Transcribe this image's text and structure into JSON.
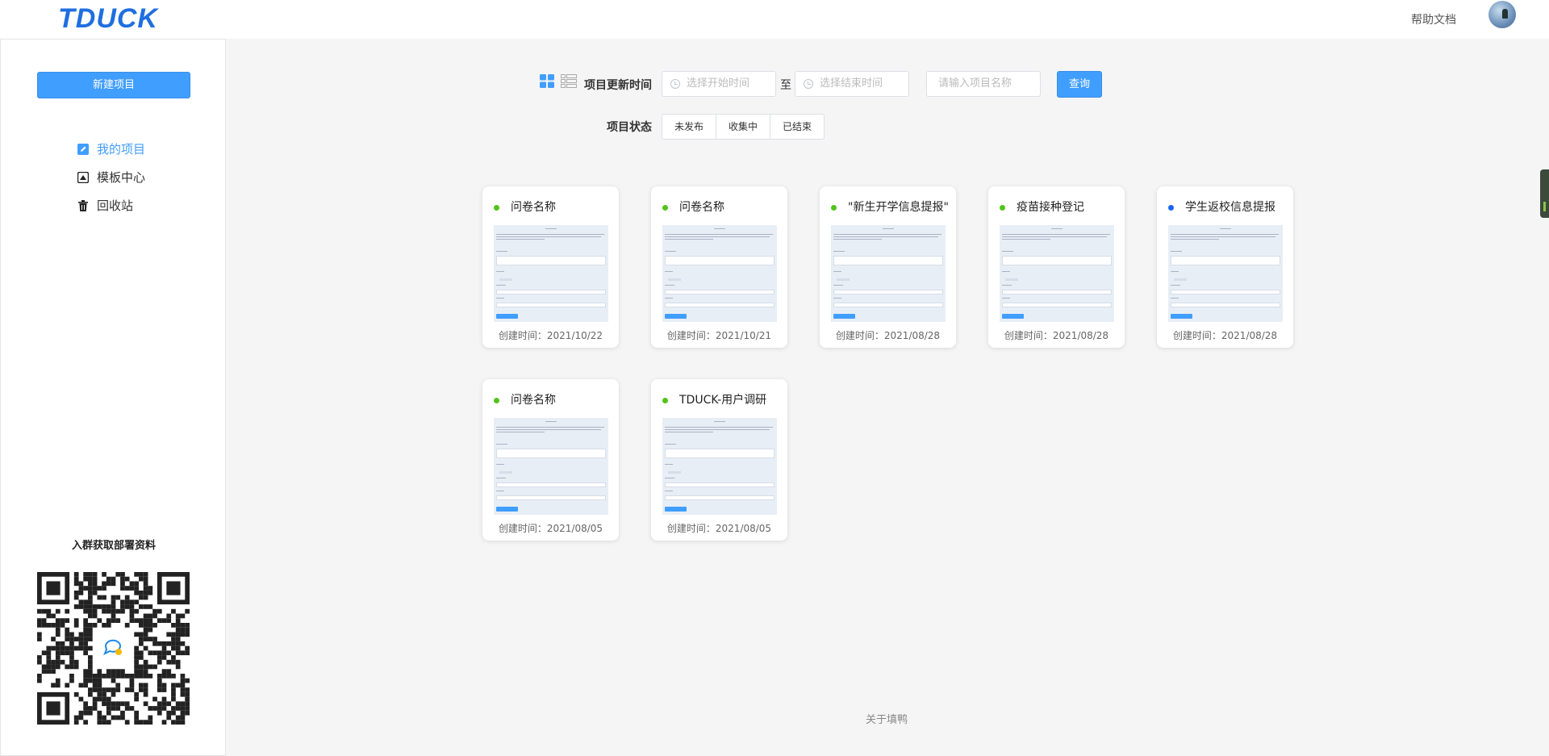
{
  "header": {
    "logo_text": "TDUCK",
    "help_link": "帮助文档"
  },
  "sidebar": {
    "new_project_button": "新建项目",
    "menu": [
      {
        "label": "我的项目",
        "icon": "edit-icon",
        "active": true
      },
      {
        "label": "模板中心",
        "icon": "template-icon",
        "active": false
      },
      {
        "label": "回收站",
        "icon": "trash-icon",
        "active": false
      }
    ],
    "qr_title": "入群获取部署资料"
  },
  "filter": {
    "update_time_label": "项目更新时间",
    "start_placeholder": "选择开始时间",
    "to_label": "至",
    "end_placeholder": "选择结束时间",
    "name_placeholder": "请输入项目名称",
    "query_button": "查询",
    "status_label": "项目状态",
    "status_options": [
      "未发布",
      "收集中",
      "已结束"
    ]
  },
  "projects": [
    {
      "title": "问卷名称",
      "created": "创建时间：2021/10/22",
      "status_color": "#52c41a"
    },
    {
      "title": "问卷名称",
      "created": "创建时间：2021/10/21",
      "status_color": "#52c41a"
    },
    {
      "title": "\"新生开学信息提报\"",
      "created": "创建时间：2021/08/28",
      "status_color": "#52c41a"
    },
    {
      "title": "疫苗接种登记",
      "created": "创建时间：2021/08/28",
      "status_color": "#52c41a"
    },
    {
      "title": "学生返校信息提报",
      "created": "创建时间：2021/08/28",
      "status_color": "#1765f0"
    },
    {
      "title": "问卷名称",
      "created": "创建时间：2021/08/05",
      "status_color": "#52c41a"
    },
    {
      "title": "TDUCK-用户调研",
      "created": "创建时间：2021/08/05",
      "status_color": "#52c41a"
    }
  ],
  "footer": {
    "about": "关于填鸭"
  },
  "colors": {
    "primary": "#409eff",
    "published": "#52c41a"
  }
}
